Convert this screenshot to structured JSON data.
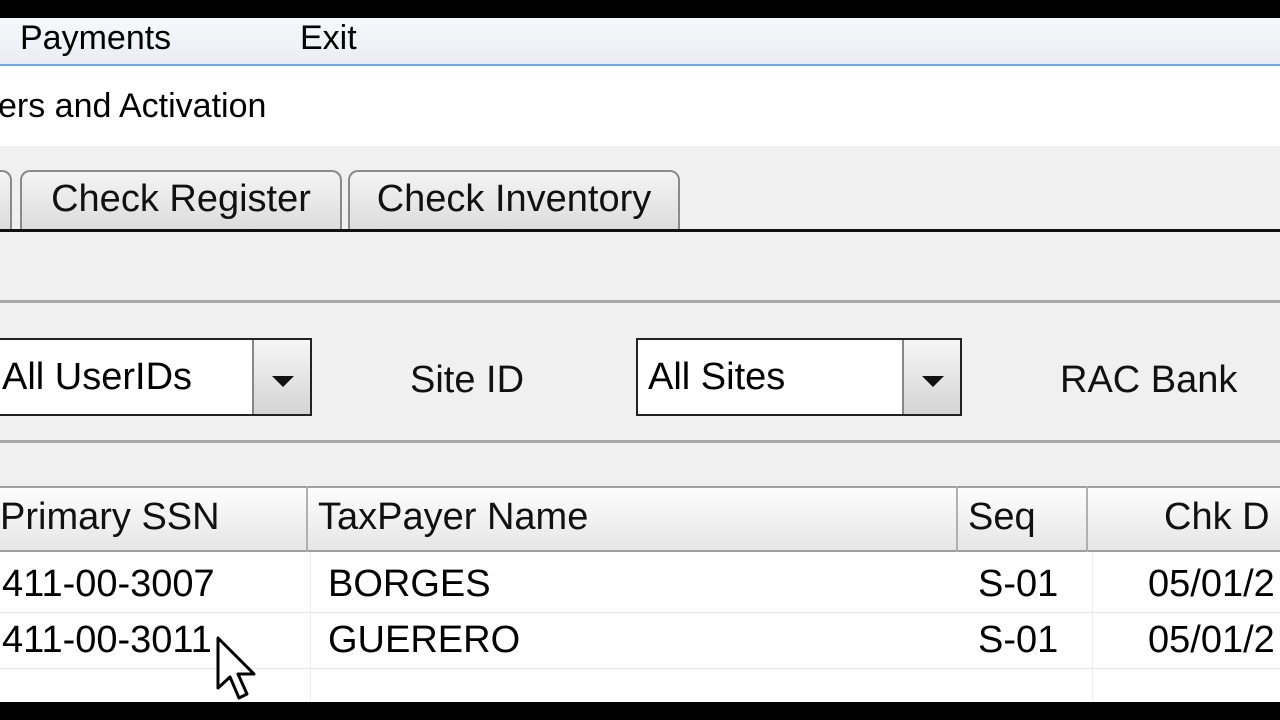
{
  "menu": {
    "payments": "Payments",
    "exit": "Exit"
  },
  "window": {
    "title": "ers and Activation"
  },
  "tabs": [
    {
      "label": "Check Register"
    },
    {
      "label": "Check Inventory"
    }
  ],
  "filters": {
    "user_combo_value": "All UserIDs",
    "site_label": "Site ID",
    "site_combo_value": "All Sites",
    "rac_bank_label": "RAC Bank"
  },
  "grid": {
    "columns": [
      "Primary SSN",
      "TaxPayer Name",
      "Seq",
      "Chk D"
    ],
    "rows": [
      {
        "ssn": "411-00-3007",
        "name": "BORGES",
        "seq": "S-01",
        "chk_date": "05/01/2"
      },
      {
        "ssn": "411-00-3011",
        "name": "GUERERO",
        "seq": "S-01",
        "chk_date": "05/01/2"
      }
    ]
  },
  "colors": {
    "menu_underline": "#6fa9e6",
    "panel_bg": "#f0f0f0"
  }
}
